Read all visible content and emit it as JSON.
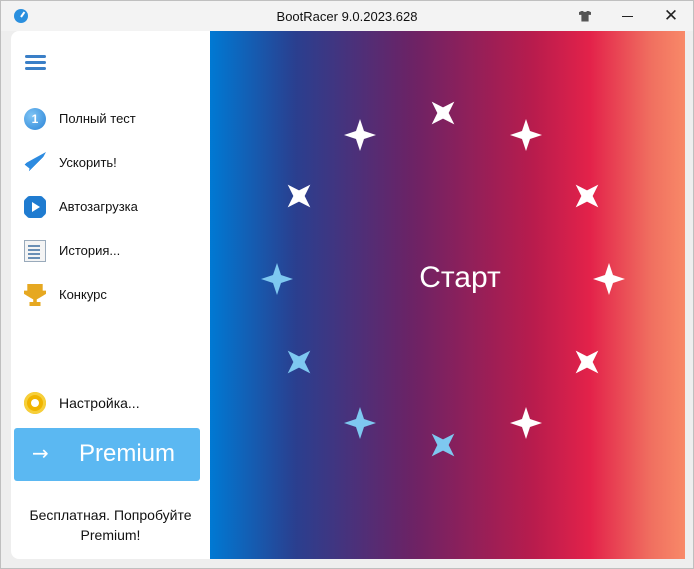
{
  "window": {
    "title": "BootRacer 9.0.2023.628",
    "close_glyph": "✕"
  },
  "sidebar": {
    "items": [
      {
        "label": "Полный тест",
        "icon": "step-one-icon",
        "icon_text": "1"
      },
      {
        "label": "Ускорить!",
        "icon": "rocket-icon"
      },
      {
        "label": "Автозагрузка",
        "icon": "autorun-icon"
      },
      {
        "label": "История...",
        "icon": "history-icon"
      },
      {
        "label": "Конкурс",
        "icon": "trophy-icon"
      }
    ],
    "settings_label": "Настройка...",
    "premium": {
      "arrow": "→",
      "label": "Premium"
    },
    "free_text_line1": "Бесплатная. Попробуйте",
    "free_text_line2": "Premium!"
  },
  "main": {
    "start_label": "Старт"
  },
  "colors": {
    "accent": "#5bb8f2",
    "star_white": "#ffffff",
    "star_blue": "#7ec8f0"
  }
}
